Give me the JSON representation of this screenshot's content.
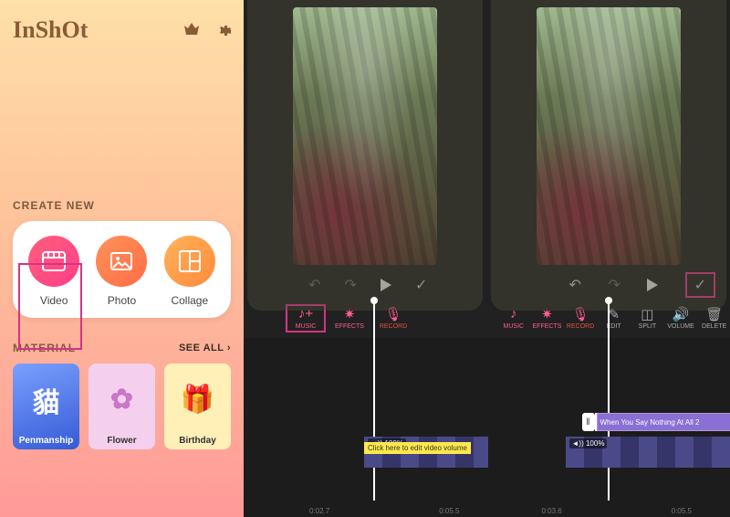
{
  "app": {
    "name": "InShOt"
  },
  "sidebar": {
    "create_title": "CREATE NEW",
    "items": [
      {
        "label": "Video"
      },
      {
        "label": "Photo"
      },
      {
        "label": "Collage"
      }
    ],
    "material_title": "MATERIAL",
    "see_all": "SEE ALL ›",
    "materials": [
      {
        "label": "Penmanship",
        "glyph": "貓"
      },
      {
        "label": "Flower",
        "glyph": "✿"
      },
      {
        "label": "Birthday",
        "glyph": "🎁"
      }
    ]
  },
  "tools": {
    "left": [
      {
        "label": "MUSIC"
      },
      {
        "label": "EFFECTS"
      },
      {
        "label": "RECORD"
      }
    ],
    "right": [
      {
        "label": "MUSIC"
      },
      {
        "label": "EFFECTS"
      },
      {
        "label": "RECORD"
      },
      {
        "label": "EDIT"
      },
      {
        "label": "SPLIT"
      },
      {
        "label": "VOLUME"
      },
      {
        "label": "DELETE"
      }
    ]
  },
  "timeline": {
    "left": {
      "volume_hint": "Click here to edit video volume",
      "volume_badge": "◄)) 100%",
      "marks": [
        "0:02.7",
        "0:05.5"
      ]
    },
    "right": {
      "audio_clip": "When You Say Nothing At All 2",
      "volume_badge": "◄)) 100%",
      "marks": [
        "0:03.6",
        "0:05.5"
      ]
    }
  }
}
